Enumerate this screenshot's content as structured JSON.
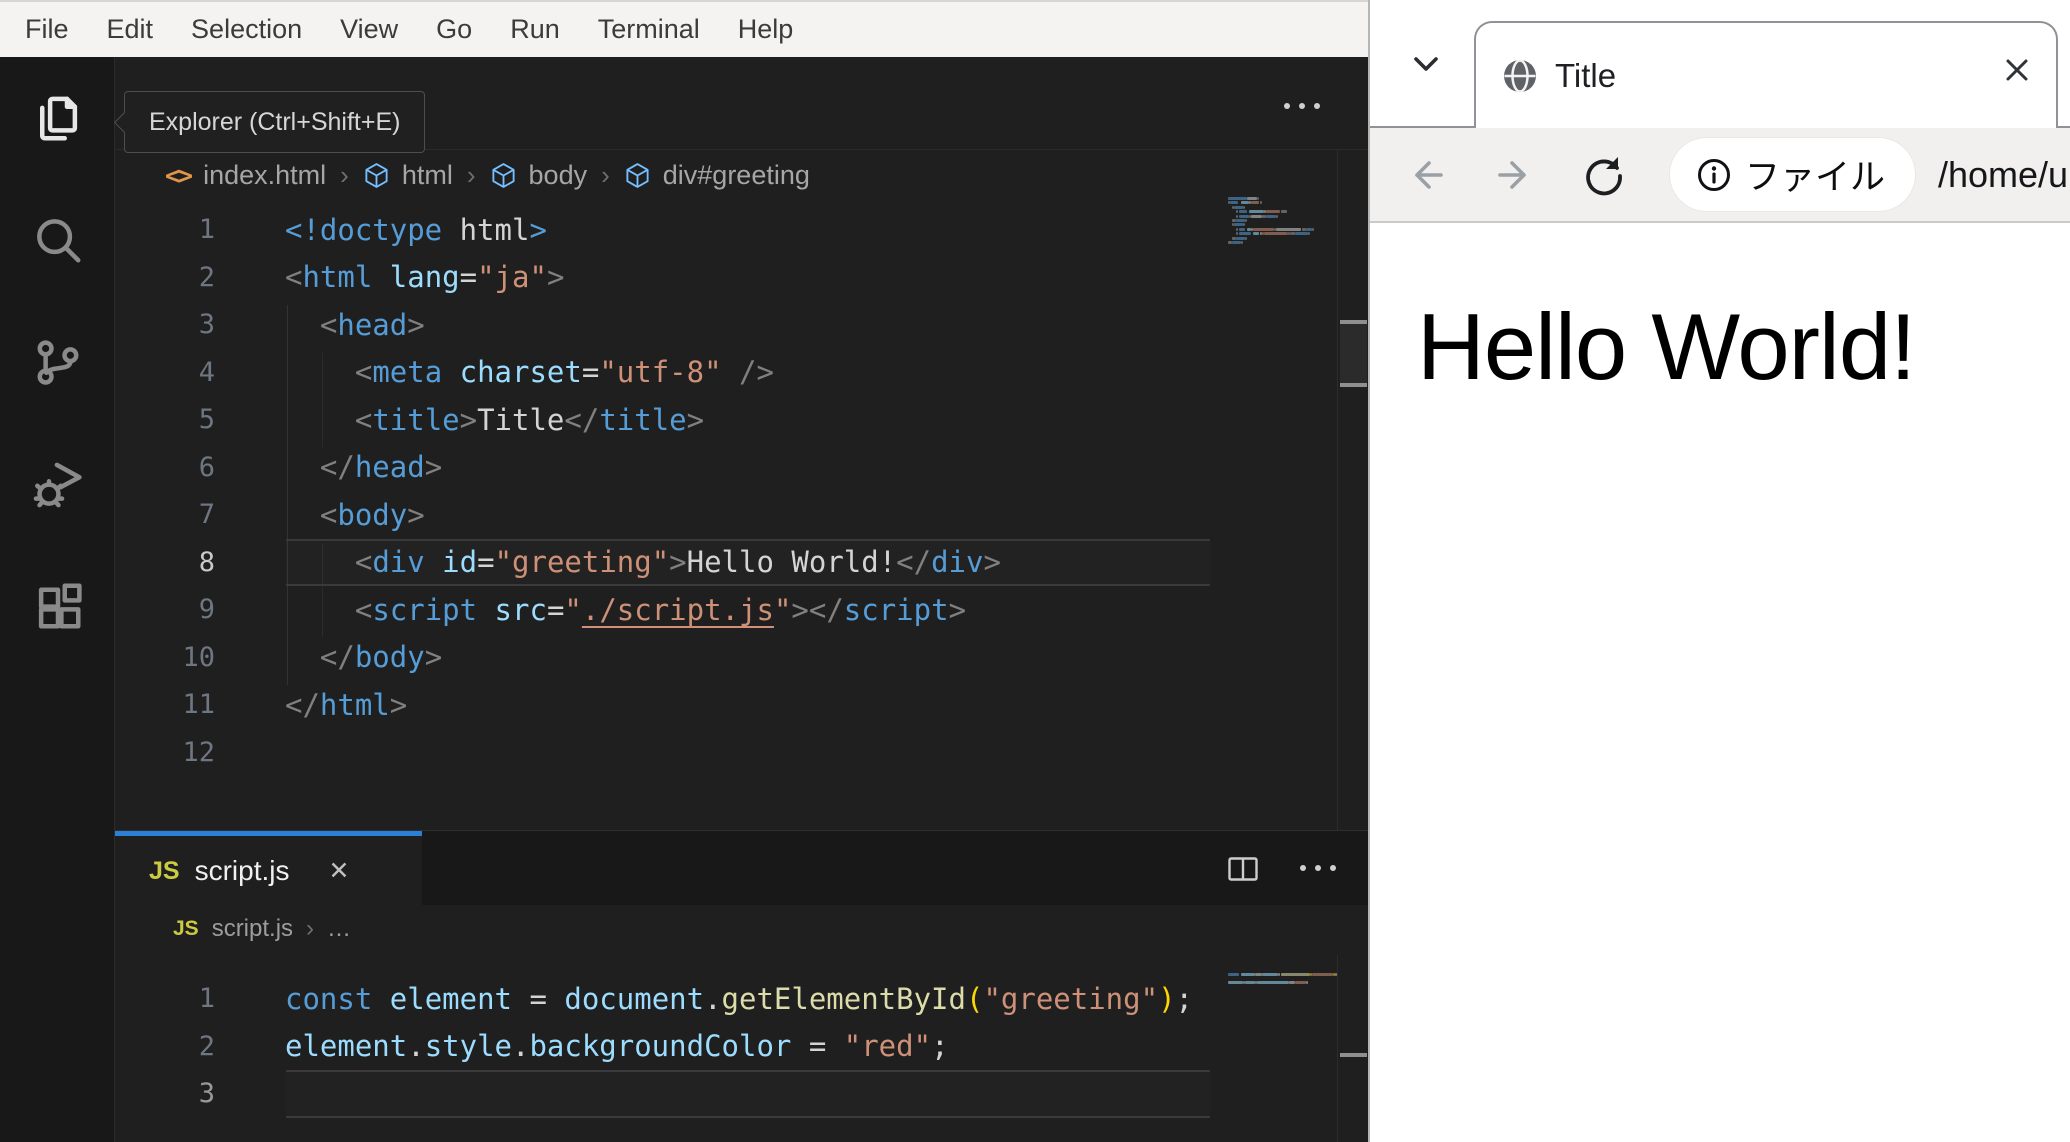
{
  "colors": {
    "banner_red": "#ea3223",
    "panel_tab_accent": "#2b7fd4",
    "menu_bg": "#f4f3f1",
    "editor_bg": "#1f1f1f",
    "activity_bg": "#181818"
  },
  "menu_bar": {
    "items": [
      "File",
      "Edit",
      "Selection",
      "View",
      "Go",
      "Run",
      "Terminal",
      "Help"
    ]
  },
  "activity_bar": {
    "tooltip": "Explorer (Ctrl+Shift+E)",
    "items": [
      {
        "name": "explorer-icon",
        "icon": "explorer",
        "active": true
      },
      {
        "name": "search-icon",
        "icon": "search",
        "active": false
      },
      {
        "name": "source-control-icon",
        "icon": "scm",
        "active": false
      },
      {
        "name": "run-debug-icon",
        "icon": "debug",
        "active": false
      },
      {
        "name": "extensions-icon",
        "icon": "extensions",
        "active": false
      }
    ]
  },
  "editor": {
    "breadcrumbs": [
      {
        "icon": "code",
        "label": "index.html"
      },
      {
        "icon": "cube",
        "label": "html"
      },
      {
        "icon": "cube",
        "label": "body"
      },
      {
        "icon": "cube",
        "label": "div#greeting"
      }
    ],
    "current_line": 8,
    "lines": [
      [
        [
          "<!doctype",
          "kw"
        ],
        [
          " html",
          "fg"
        ],
        [
          ">",
          "kw"
        ]
      ],
      [
        [
          "<",
          "pn"
        ],
        [
          "html",
          "kw"
        ],
        [
          " ",
          "fg"
        ],
        [
          "lang",
          "at"
        ],
        [
          "=",
          "fg"
        ],
        [
          "\"ja\"",
          "st"
        ],
        [
          ">",
          "pn"
        ]
      ],
      [
        [
          "  ",
          "fg"
        ],
        [
          "<",
          "pn"
        ],
        [
          "head",
          "kw"
        ],
        [
          ">",
          "pn"
        ]
      ],
      [
        [
          "    ",
          "fg"
        ],
        [
          "<",
          "pn"
        ],
        [
          "meta",
          "kw"
        ],
        [
          " ",
          "fg"
        ],
        [
          "charset",
          "at"
        ],
        [
          "=",
          "fg"
        ],
        [
          "\"utf-8\"",
          "st"
        ],
        [
          " />",
          "pn"
        ]
      ],
      [
        [
          "    ",
          "fg"
        ],
        [
          "<",
          "pn"
        ],
        [
          "title",
          "kw"
        ],
        [
          ">",
          "pn"
        ],
        [
          "Title",
          "fg"
        ],
        [
          "</",
          "pn"
        ],
        [
          "title",
          "kw"
        ],
        [
          ">",
          "pn"
        ]
      ],
      [
        [
          "  ",
          "fg"
        ],
        [
          "</",
          "pn"
        ],
        [
          "head",
          "kw"
        ],
        [
          ">",
          "pn"
        ]
      ],
      [
        [
          "  ",
          "fg"
        ],
        [
          "<",
          "pn"
        ],
        [
          "body",
          "kw"
        ],
        [
          ">",
          "pn"
        ]
      ],
      [
        [
          "    ",
          "fg"
        ],
        [
          "<",
          "pn"
        ],
        [
          "div",
          "kw"
        ],
        [
          " ",
          "fg"
        ],
        [
          "id",
          "at"
        ],
        [
          "=",
          "fg"
        ],
        [
          "\"greeting\"",
          "st"
        ],
        [
          ">",
          "pn"
        ],
        [
          "Hello World!",
          "fg"
        ],
        [
          "</",
          "pn"
        ],
        [
          "div",
          "kw"
        ],
        [
          ">",
          "pn"
        ]
      ],
      [
        [
          "    ",
          "fg"
        ],
        [
          "<",
          "pn"
        ],
        [
          "script",
          "kw"
        ],
        [
          " ",
          "fg"
        ],
        [
          "src",
          "at"
        ],
        [
          "=",
          "fg"
        ],
        [
          "\"",
          "st"
        ],
        [
          "./script.js",
          "lk"
        ],
        [
          "\"",
          "st"
        ],
        [
          ">",
          "pn"
        ],
        [
          "</",
          "pn"
        ],
        [
          "script",
          "kw"
        ],
        [
          ">",
          "pn"
        ]
      ],
      [
        [
          "  ",
          "fg"
        ],
        [
          "</",
          "pn"
        ],
        [
          "body",
          "kw"
        ],
        [
          ">",
          "pn"
        ]
      ],
      [
        [
          "</",
          "pn"
        ],
        [
          "html",
          "kw"
        ],
        [
          ">",
          "pn"
        ]
      ],
      []
    ]
  },
  "panel": {
    "tab": {
      "icon_label": "JS",
      "label": "script.js",
      "close": "✕"
    },
    "breadcrumbs_icon": "JS",
    "breadcrumbs": [
      {
        "icon": "js",
        "label": "script.js"
      },
      {
        "label": "…"
      }
    ],
    "current_line": 3,
    "lines": [
      [
        [
          "const",
          "kw"
        ],
        [
          " ",
          "fg"
        ],
        [
          "element",
          "vr"
        ],
        [
          " = ",
          "fg"
        ],
        [
          "document",
          "vr"
        ],
        [
          ".",
          "fg"
        ],
        [
          "getElementById",
          "fn"
        ],
        [
          "(",
          "gd"
        ],
        [
          "\"greeting\"",
          "st"
        ],
        [
          ")",
          "gd"
        ],
        [
          ";",
          "fg"
        ]
      ],
      [
        [
          "element",
          "vr"
        ],
        [
          ".",
          "fg"
        ],
        [
          "style",
          "vr"
        ],
        [
          ".",
          "fg"
        ],
        [
          "backgroundColor",
          "vr"
        ],
        [
          " = ",
          "fg"
        ],
        [
          "\"red\"",
          "st"
        ],
        [
          ";",
          "fg"
        ]
      ],
      []
    ]
  },
  "browser": {
    "tab": {
      "title": "Title"
    },
    "address": {
      "chip_label": "ファイル",
      "path": "/home/u"
    },
    "page": {
      "text": "Hello World!"
    }
  }
}
